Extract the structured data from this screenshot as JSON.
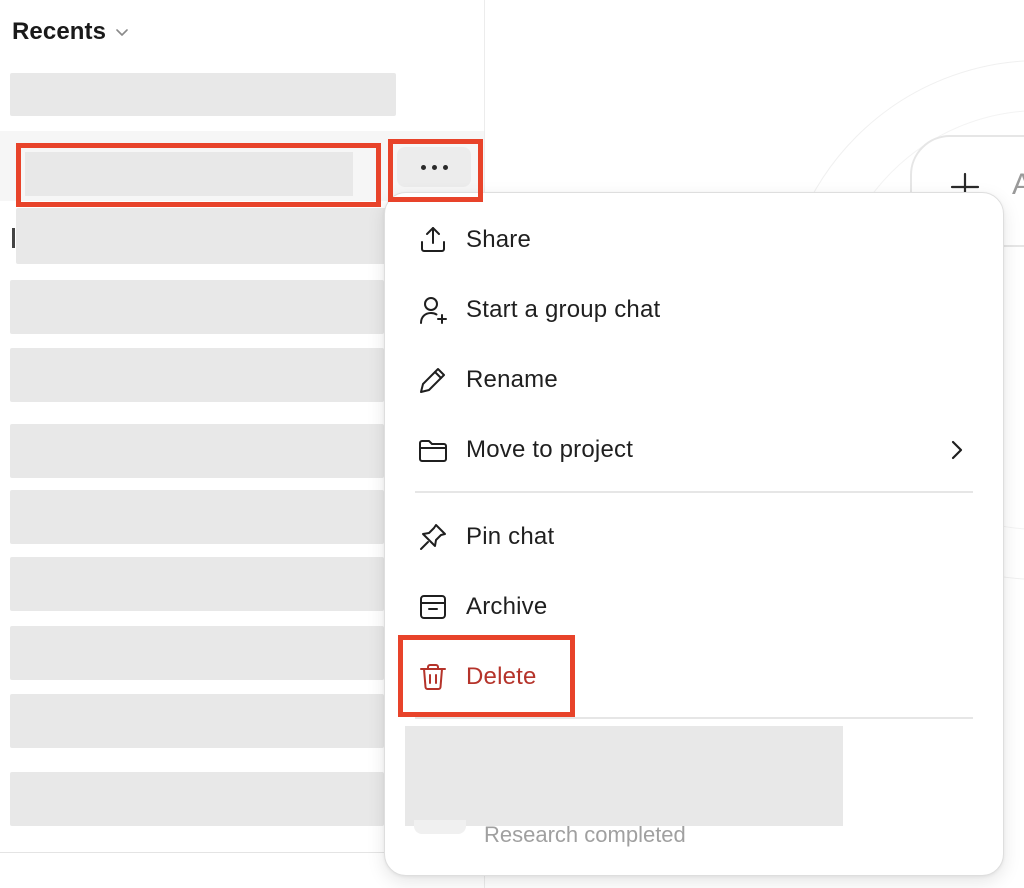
{
  "sidebar": {
    "recents_title": "Recents",
    "chevron_icon": "chevron-down-icon",
    "chat_rows_redacted": 11,
    "row_more_icon": "more-horizontal-icon"
  },
  "main": {
    "input_plus_icon": "plus-icon",
    "input_placeholder_partial": "A"
  },
  "context_menu": {
    "items": [
      {
        "label": "Share",
        "icon": "share-icon"
      },
      {
        "label": "Start a group chat",
        "icon": "add-user-icon"
      },
      {
        "label": "Rename",
        "icon": "pencil-icon"
      },
      {
        "label": "Move to project",
        "icon": "folder-icon",
        "submenu_icon": "chevron-right-icon"
      },
      {
        "label": "Pin chat",
        "icon": "pin-icon"
      },
      {
        "label": "Archive",
        "icon": "archive-icon"
      },
      {
        "label": "Delete",
        "icon": "trash-icon",
        "danger": true
      }
    ],
    "footer_status": "Research completed"
  },
  "colors": {
    "highlight": "#e8432a",
    "danger_text": "#b5332a",
    "redaction": "#e8e8e8",
    "menu_border": "#dedede"
  }
}
